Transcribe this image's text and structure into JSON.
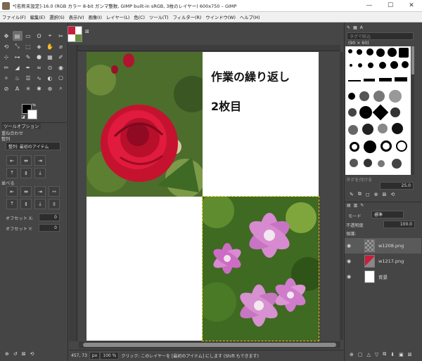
{
  "window": {
    "title": "*[名称未設定]-16.0 (RGB カラー 8-bit ガンマ整数, GIMP built-in sRGB, 3枚のレイヤー) 600x750 – GIMP",
    "minimize": "—",
    "maximize": "☐",
    "close": "✕"
  },
  "menu": [
    "ファイル(F)",
    "編集(E)",
    "選択(S)",
    "表示(V)",
    "画像(I)",
    "レイヤー(L)",
    "色(C)",
    "ツール(T)",
    "フィルター(R)",
    "ウインドウ(W)",
    "ヘルプ(H)"
  ],
  "toolbox": {
    "tools": [
      "✥",
      "▤",
      "▭",
      "ʘ",
      "⌖",
      "✂",
      "⟲",
      "⤡",
      "⬚",
      "◈",
      "✋",
      "⌀",
      "⊹",
      "⊶",
      "✎",
      "⬣",
      "▦",
      "✐",
      "✏",
      "◢",
      "✒",
      "≈",
      "⊙",
      "◉",
      "✧",
      "♨",
      "☰",
      "∿",
      "◐",
      "⎔",
      "⊘",
      "A",
      "✳",
      "✱",
      "⊕",
      "⌕"
    ],
    "tab_label": "ツールオプション",
    "section1": "重ね合わせ",
    "section1_sub": "整列",
    "relative_label": "整列: 最初のアイテム",
    "section2": "並べる",
    "offset_x_label": "オフセット X:",
    "offset_x_value": "0",
    "offset_y_label": "オフセット Y:",
    "offset_y_value": "0",
    "swap_icon": "⇆",
    "reset_icon": "◪",
    "foot": [
      "⊕",
      "↺",
      "⊠",
      "⟲"
    ]
  },
  "canvas": {
    "caption_line1": "作業の繰り返し",
    "caption_line2": "2枚目"
  },
  "status": {
    "coords": "457, 73",
    "unit": "px",
    "zoom": "100 %",
    "message": "クリック: このレイヤーを [最初のアイテム] にします (Shift もできます)"
  },
  "brushes": {
    "filter_placeholder": "タグで絞込",
    "name": "2. Hardness 050 (51 × 51)",
    "size_label": "(90 × 60)",
    "tag_label": "タグを付ける",
    "spacing": "25.0",
    "foot": [
      "✎",
      "⧉",
      "◻",
      "⊕",
      "⊠",
      "⟲"
    ]
  },
  "layers": {
    "mode_label": "モード",
    "mode_value": "標準",
    "opacity_label": "不透明度",
    "opacity_value": "100.0",
    "lock_label": "保護:",
    "items": [
      {
        "name": "w1208.png",
        "selected": true,
        "visible": true
      },
      {
        "name": "w1217.png",
        "selected": false,
        "visible": true
      },
      {
        "name": "背景",
        "selected": false,
        "visible": true
      }
    ],
    "foot": [
      "⊕",
      "▢",
      "△",
      "▽",
      "⧉",
      "⬇",
      "▣",
      "⊠"
    ]
  }
}
